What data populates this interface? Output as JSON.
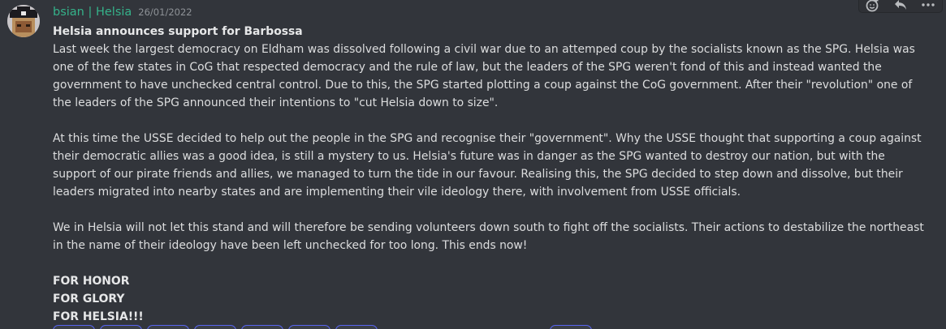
{
  "message": {
    "username": "bsian | Helsia",
    "timestamp": "26/01/2022",
    "title": "Helsia announces support for Barbossa",
    "paragraph1": "Last week the largest democracy on Eldham was dissolved following a civil war due to an attemped coup by the socialists known as the SPG. Helsia was one of the few states in CoG that respected democracy and the rule of law, but the leaders of the SPG weren't fond of this and instead wanted the government to have unchecked central control. Due to this, the SPG started plotting a coup against the CoG government. After their \"revolution\" one of the leaders of the SPG announced their intentions to \"cut Helsia down to size\".",
    "paragraph2": "At this time the USSE decided to help out the people in the SPG and recognise their \"government\". Why the USSE thought that supporting a coup against their democratic allies was a good idea, is still a mystery to us. Helsia's future was in danger as the SPG wanted to destroy our nation, but with the support of our pirate friends and allies, we managed to turn the tide in our favour. Realising this, the SPG decided to step down and dissolve, but their leaders migrated into nearby states and are implementing their vile ideology there, with involvement from USSE officials.",
    "paragraph3": "We in Helsia will not let this stand and will therefore be sending volunteers down south to fight off the socialists. Their actions to destabilize the northeast in the name of their ideology have been left unchecked for too long. This ends now!",
    "closing": [
      "FOR HONOR",
      "FOR GLORY",
      "FOR HELSIA!!!"
    ]
  },
  "toolbar": {
    "icons": [
      "add-reaction-icon",
      "reply-icon",
      "more-options-icon"
    ]
  },
  "colors": {
    "background": "#32353b",
    "username": "#35b28a",
    "text": "#dcddde",
    "timestamp": "#8e9297",
    "reaction_border": "#5865f2"
  }
}
